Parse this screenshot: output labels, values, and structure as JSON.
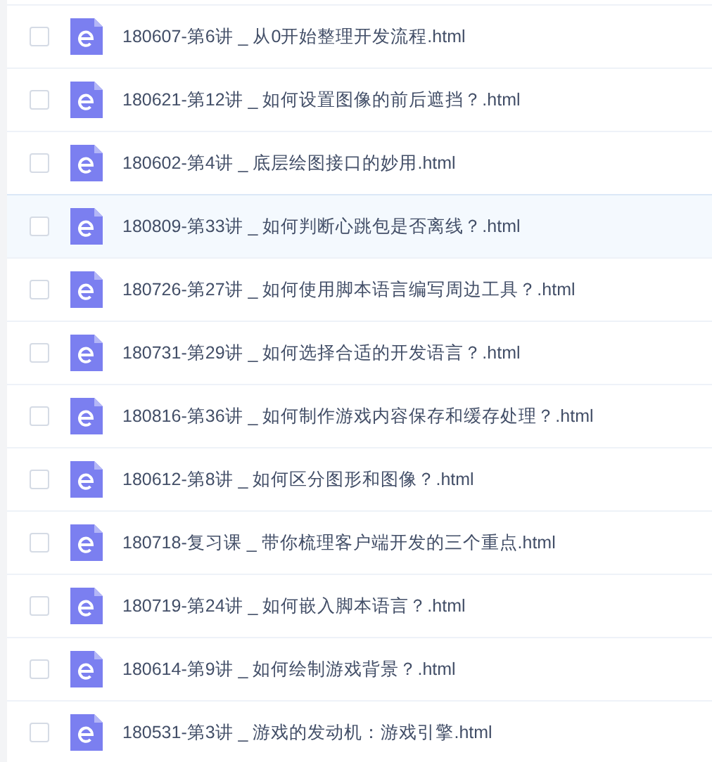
{
  "files": [
    {
      "name": "180607-第6讲 _ 从0开始整理开发流程.html",
      "checked": false,
      "selected": false
    },
    {
      "name": "180621-第12讲 _ 如何设置图像的前后遮挡？.html",
      "checked": false,
      "selected": false
    },
    {
      "name": "180602-第4讲 _ 底层绘图接口的妙用.html",
      "checked": false,
      "selected": false
    },
    {
      "name": "180809-第33讲 _ 如何判断心跳包是否离线？.html",
      "checked": false,
      "selected": true
    },
    {
      "name": "180726-第27讲 _ 如何使用脚本语言编写周边工具？.html",
      "checked": false,
      "selected": false
    },
    {
      "name": "180731-第29讲 _ 如何选择合适的开发语言？.html",
      "checked": false,
      "selected": false
    },
    {
      "name": "180816-第36讲 _ 如何制作游戏内容保存和缓存处理？.html",
      "checked": false,
      "selected": false
    },
    {
      "name": "180612-第8讲 _ 如何区分图形和图像？.html",
      "checked": false,
      "selected": false
    },
    {
      "name": "180718-复习课 _ 带你梳理客户端开发的三个重点.html",
      "checked": false,
      "selected": false
    },
    {
      "name": "180719-第24讲 _ 如何嵌入脚本语言？.html",
      "checked": false,
      "selected": false
    },
    {
      "name": "180614-第9讲 _ 如何绘制游戏背景？.html",
      "checked": false,
      "selected": false
    },
    {
      "name": "180531-第3讲 _ 游戏的发动机：游戏引擎.html",
      "checked": false,
      "selected": false
    }
  ]
}
